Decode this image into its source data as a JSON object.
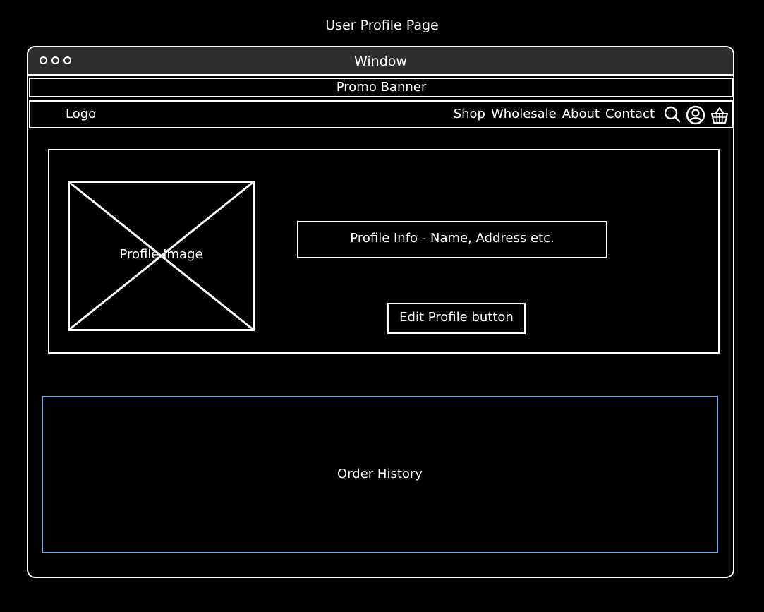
{
  "page_title": "User Profile Page",
  "window": {
    "title": "Window"
  },
  "promo_banner": "Promo Banner",
  "nav": {
    "logo": "Logo",
    "links": [
      "Shop",
      "Wholesale",
      "About",
      "Contact"
    ],
    "icons": [
      "search-icon",
      "user-icon",
      "basket-icon"
    ]
  },
  "profile": {
    "image_label": "Profile Image",
    "info_label": "Profile Info - Name, Address etc.",
    "edit_button": "Edit Profile button"
  },
  "order_history": "Order History",
  "colors": {
    "background": "#000000",
    "stroke": "#ffffff",
    "titlebar": "#2e2e2e",
    "order_history_border": "#7aa7e8"
  }
}
